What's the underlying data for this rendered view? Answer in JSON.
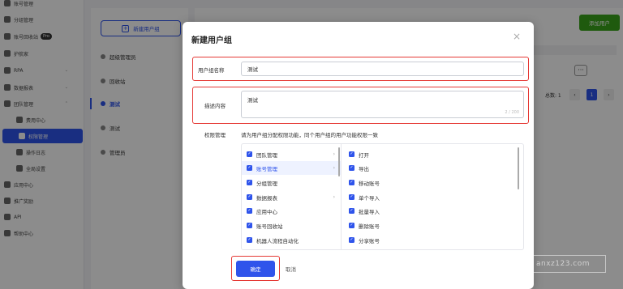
{
  "sidebar": {
    "items": [
      {
        "label": "账号管理",
        "icon": "user-icon",
        "top": 0
      },
      {
        "label": "分组管理",
        "icon": "group-icon"
      },
      {
        "label": "账号回收站",
        "icon": "trash-icon",
        "badge": "Pro"
      },
      {
        "label": "护航家",
        "icon": "shield-icon"
      },
      {
        "label": "RPA",
        "icon": "robot-icon",
        "chev": "⌄"
      },
      {
        "label": "数据报表",
        "icon": "chart-icon",
        "chev": "⌄"
      },
      {
        "label": "团队管理",
        "icon": "team-icon",
        "chev": "⌃"
      },
      {
        "label": "费用中心",
        "icon": "dollar-icon"
      },
      {
        "label": "权限管理",
        "icon": "permission-icon"
      },
      {
        "label": "操作日志",
        "icon": "log-icon"
      },
      {
        "label": "全局设置",
        "icon": "gear-icon"
      },
      {
        "label": "应用中心",
        "icon": "apps-icon"
      },
      {
        "label": "推广奖励",
        "icon": "gift-icon"
      },
      {
        "label": "API",
        "icon": "api-icon"
      },
      {
        "label": "帮助中心",
        "icon": "help-icon"
      }
    ]
  },
  "groups": {
    "new_button": "新建用户组",
    "items": [
      "超级管理员",
      "回收站",
      "测试",
      "测试",
      "管理员"
    ]
  },
  "content": {
    "add_user_button": "添加用户",
    "more": "···",
    "total": "总数: 1",
    "pager_prev": "‹",
    "pager_current": "1",
    "pager_next": "›"
  },
  "modal": {
    "title": "新建用户组",
    "close": "×",
    "name_label": "用户组名称",
    "name_value": "测试",
    "desc_label": "描述内容",
    "desc_value": "测试",
    "desc_count": "2 / 200",
    "perm_label": "权限管理",
    "perm_hint": "请为用户组分配权限功能，同个用户组的用户功能权限一致",
    "perm_left": [
      {
        "label": "团队管理",
        "chev": "›"
      },
      {
        "label": "账号管理",
        "chev": "›"
      },
      {
        "label": "分组管理",
        "chev": ""
      },
      {
        "label": "数据报表",
        "chev": "›"
      },
      {
        "label": "应用中心",
        "chev": ""
      },
      {
        "label": "账号回收站",
        "chev": ""
      },
      {
        "label": "机器人流程自动化",
        "chev": ""
      }
    ],
    "perm_right": [
      "打开",
      "导出",
      "移动账号",
      "单个导入",
      "批量导入",
      "删除账号",
      "分享账号"
    ],
    "ok_button": "确定",
    "cancel_button": "取消"
  },
  "watermark": "anxz123.com",
  "colors": {
    "primary": "#2f54eb",
    "highlight": "#e53935",
    "green": "#3aa51a"
  }
}
